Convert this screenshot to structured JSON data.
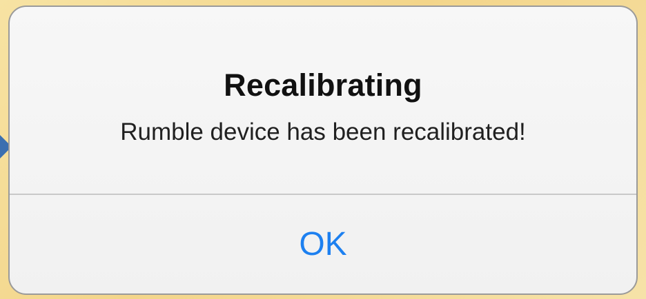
{
  "alert": {
    "title": "Recalibrating",
    "message": "Rumble device has been recalibrated!",
    "button_label": "OK"
  },
  "colors": {
    "background": "#f3d58a",
    "accent": "#1d80f0",
    "pointer": "#3b6fb0"
  },
  "icons": {
    "pointer": "pointer-arrow-icon"
  }
}
